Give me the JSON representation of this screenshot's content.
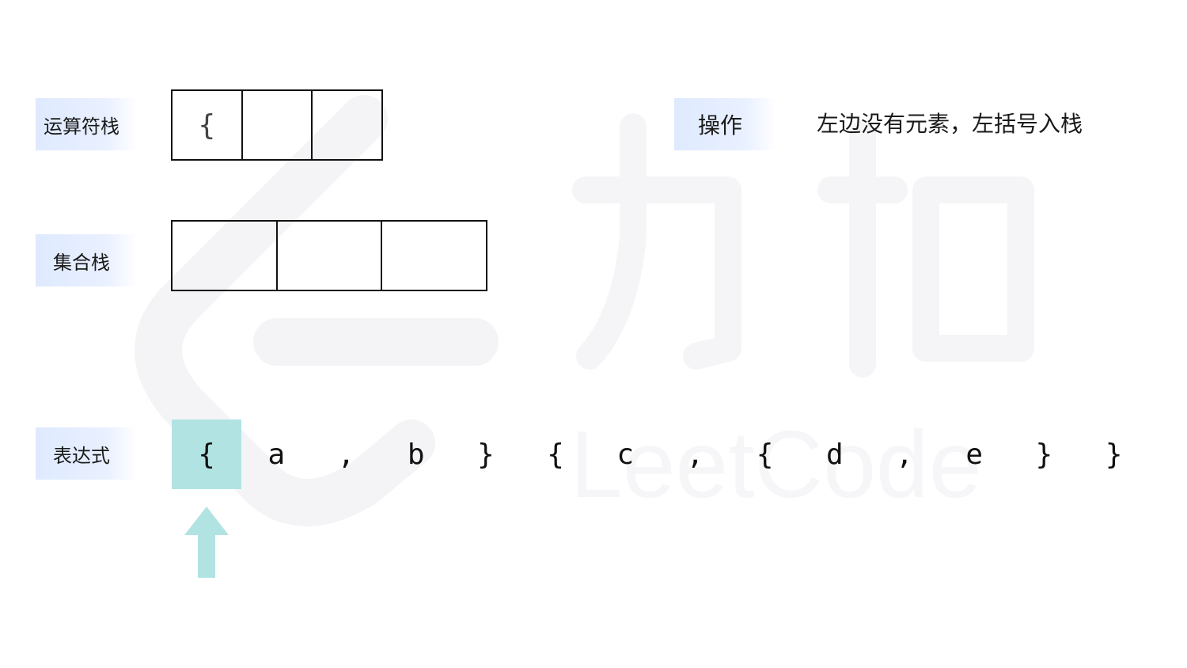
{
  "labels": {
    "operator_stack": "运算符栈",
    "set_stack": "集合栈",
    "expression": "表达式"
  },
  "operator_stack": {
    "cells": [
      "{",
      "",
      ""
    ]
  },
  "set_stack": {
    "cells": [
      "",
      "",
      ""
    ]
  },
  "operation": {
    "label": "操作",
    "text": "左边没有元素，左括号入栈"
  },
  "expression": {
    "tokens": [
      "{",
      "a",
      ",",
      "b",
      "}",
      "{",
      "c",
      ",",
      "{",
      "d",
      ",",
      "e",
      "}",
      "}"
    ],
    "active_index": 0
  },
  "colors": {
    "label_bg": "#dfeaff",
    "highlight": "#b2e3e3",
    "watermark": "#f4f4f6"
  },
  "watermark": {
    "brand_cn": "力扣",
    "brand_en": "LeetCode"
  }
}
